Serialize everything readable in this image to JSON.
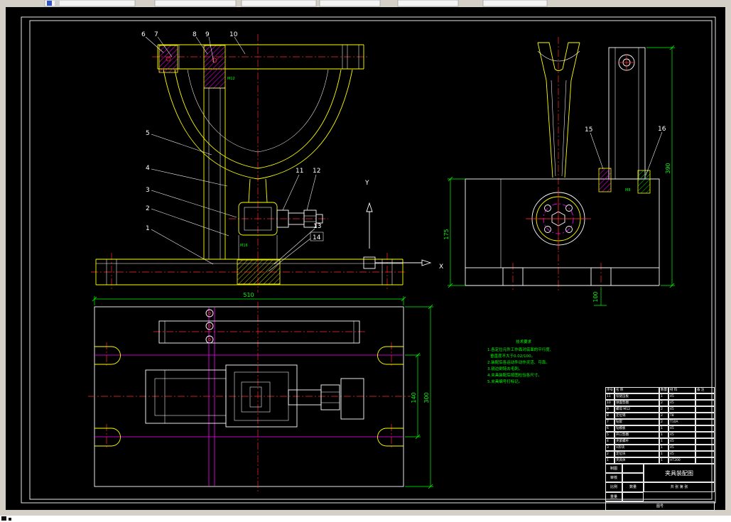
{
  "palette": {
    "canvas_bg": "#000000",
    "geometry_yellow": "#ffff00",
    "geometry_white": "#ffffff",
    "centerline_red": "#ff2a2a",
    "dimension_green": "#00ff00",
    "hatch_magenta": "#ff00ff"
  },
  "axes": {
    "x": "X",
    "y": "Y"
  },
  "callouts": [
    "1",
    "2",
    "3",
    "4",
    "5",
    "6",
    "7",
    "8",
    "9",
    "10",
    "11",
    "12",
    "13",
    "14",
    "15",
    "16"
  ],
  "dims": {
    "plan_width": "510",
    "plan_height": "300",
    "plan_inner": "140",
    "side_height": "390",
    "side_inner": "175",
    "side_base": "100"
  },
  "threads": {
    "front_top": "M12",
    "front_base": "M16",
    "side_clamp": "M8"
  },
  "notes": {
    "title": "技术要求",
    "lines": [
      "1.各定位元件工作面对底面的平行度、",
      "垂直度不大于0.02/100。",
      "2.装配后各运动件动作灵活、可靠。",
      "3.锐边倒钝去毛刺。",
      "4.夹具装配后按图检验各尺寸。",
      "5.夹具编号打标记。"
    ]
  },
  "titleblock": {
    "headers": [
      "序号",
      "名 称",
      "数量",
      "材 料",
      "备 注"
    ],
    "bom": [
      [
        "11",
        "铰链压板",
        "1",
        "45",
        ""
      ],
      [
        "10",
        "球面垫圈",
        "2",
        "45",
        ""
      ],
      [
        "9",
        "螺母 M12",
        "2",
        "45",
        ""
      ],
      [
        "8",
        "定位销",
        "2",
        "T8",
        ""
      ],
      [
        "7",
        "钻套",
        "2",
        "T10A",
        ""
      ],
      [
        "6",
        "钻模板",
        "1",
        "45",
        ""
      ],
      [
        "5",
        "开口垫圈",
        "1",
        "45",
        ""
      ],
      [
        "4",
        "夹紧螺杆",
        "1",
        "45",
        ""
      ],
      [
        "3",
        "V形块",
        "1",
        "45",
        ""
      ],
      [
        "2",
        "定位块",
        "1",
        "45",
        ""
      ],
      [
        "1",
        "夹具体",
        "1",
        "HT200",
        ""
      ]
    ],
    "info": {
      "draw": "制图",
      "check": "审核",
      "scale": "比例",
      "qty": "数量",
      "weight": "重量",
      "sheet": "共 张  第 张",
      "title": "夹具装配图",
      "code": "图号"
    }
  }
}
